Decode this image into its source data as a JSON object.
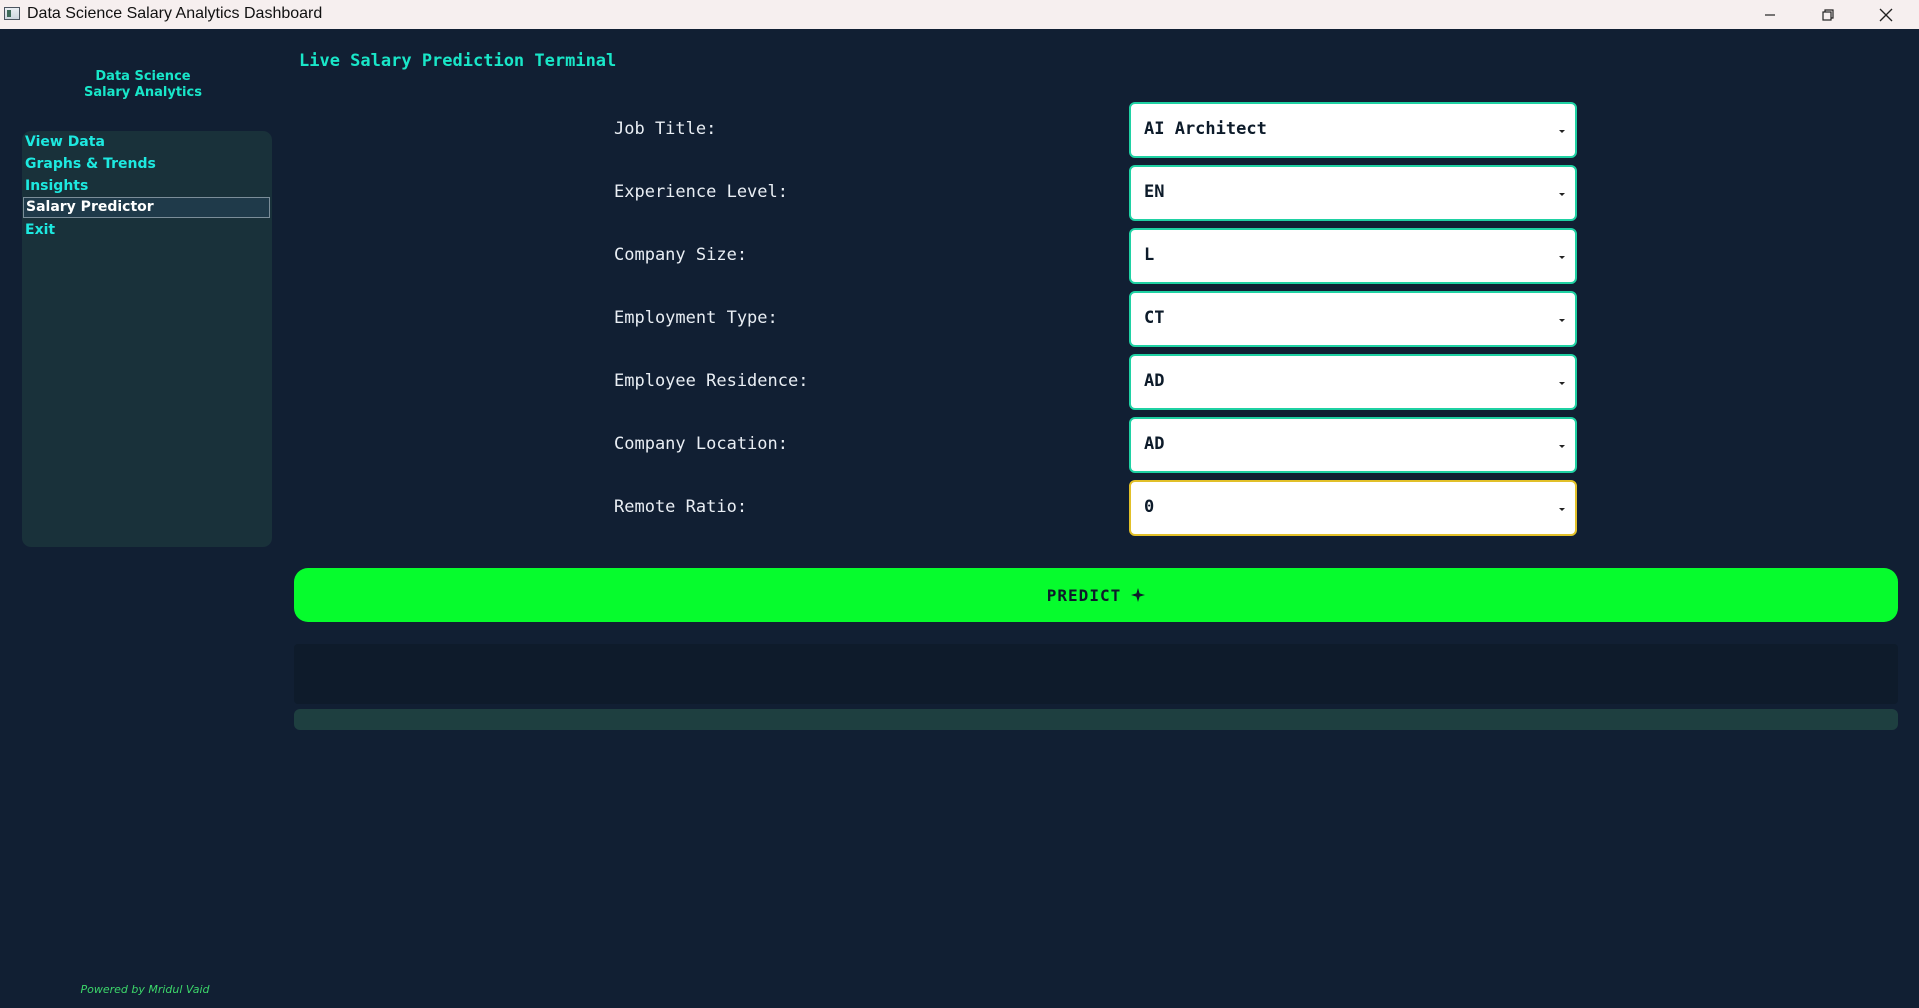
{
  "window": {
    "title": "Data Science Salary Analytics Dashboard",
    "icons": [
      "app-window-icon",
      "minimize-icon",
      "restore-icon",
      "close-icon"
    ]
  },
  "sidebar": {
    "brand_line1": "Data Science",
    "brand_line2": "Salary Analytics",
    "items": [
      {
        "label": "View Data"
      },
      {
        "label": "Graphs & Trends"
      },
      {
        "label": "Insights"
      },
      {
        "label": "Salary Predictor",
        "active": true
      },
      {
        "label": "Exit"
      }
    ],
    "footer": "Powered by Mridul Vaid"
  },
  "main": {
    "title": "Live Salary Prediction Terminal",
    "fields": [
      {
        "label": "Job Title:",
        "value": "AI Architect"
      },
      {
        "label": "Experience Level:",
        "value": "EN"
      },
      {
        "label": "Company Size:",
        "value": "L"
      },
      {
        "label": "Employment Type:",
        "value": "CT"
      },
      {
        "label": "Employee Residence:",
        "value": "AD"
      },
      {
        "label": "Company Location:",
        "value": "AD"
      },
      {
        "label": "Remote Ratio:",
        "value": "0"
      }
    ],
    "predict_label": "PREDICT",
    "predict_icon": "sparkle-icon",
    "result_text": "",
    "progress": 0
  },
  "colors": {
    "background": "#111f33",
    "accent": "#18e6c9",
    "predict_button": "#06fc2d",
    "combo_border": "#1fd1a3",
    "focus_border": "#e2c029",
    "sidebar_panel": "#19313a"
  }
}
